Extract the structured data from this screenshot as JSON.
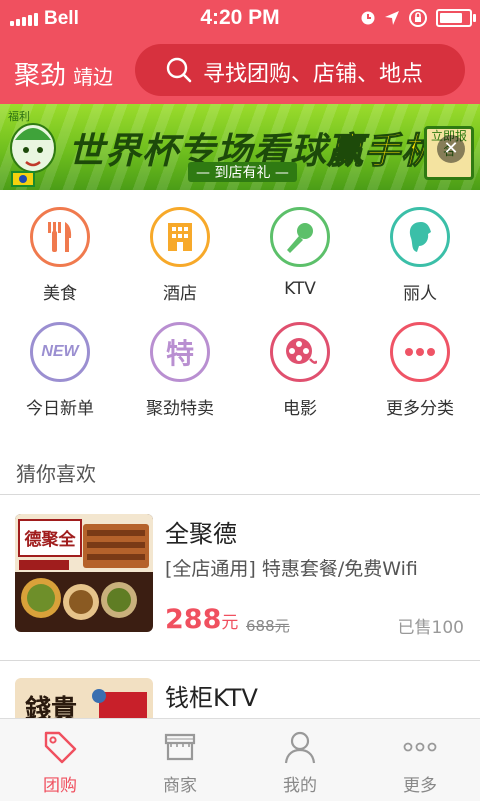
{
  "status_bar": {
    "carrier": "Bell",
    "time": "4:20 PM",
    "battery_level": 0.9
  },
  "header": {
    "brand": "聚劲",
    "city": "靖边",
    "search_placeholder": "寻找团购、店铺、地点"
  },
  "banner": {
    "tag": "福利",
    "headline_left": "世界杯专场看球",
    "headline_right": "赢手机",
    "subline": "— 到店有礼 —",
    "badge": "立即报名"
  },
  "categories": [
    {
      "label": "美食",
      "icon": "fork-knife-icon",
      "color": "#f07a4e"
    },
    {
      "label": "酒店",
      "icon": "hotel-building-icon",
      "color": "#f7a92a"
    },
    {
      "label": "KTV",
      "icon": "microphone-icon",
      "color": "#5cc06a"
    },
    {
      "label": "丽人",
      "icon": "beauty-face-icon",
      "color": "#3bbfa8"
    },
    {
      "label": "今日新单",
      "icon": "new-badge-icon",
      "color": "#9b8fd1"
    },
    {
      "label": "聚劲特卖",
      "icon": "special-sale-icon",
      "color": "#b98fd1"
    },
    {
      "label": "电影",
      "icon": "film-reel-icon",
      "color": "#e0506f"
    },
    {
      "label": "更多分类",
      "icon": "more-dots-icon",
      "color": "#ef5466"
    }
  ],
  "section_title": "猜你喜欢",
  "deals": [
    {
      "name": "全聚德",
      "desc": "[全店通用] 特惠套餐/免费Wifi",
      "price": "288",
      "unit": "元",
      "original": "688元",
      "sold": "已售100"
    },
    {
      "name": "钱柜KTV"
    }
  ],
  "tabs": [
    {
      "label": "团购",
      "icon": "tag-icon",
      "active": true
    },
    {
      "label": "商家",
      "icon": "store-icon",
      "active": false
    },
    {
      "label": "我的",
      "icon": "user-icon",
      "active": false
    },
    {
      "label": "更多",
      "icon": "more-icon",
      "active": false
    }
  ],
  "colors": {
    "brand": "#f0505f",
    "search_bg": "#d7313e"
  }
}
